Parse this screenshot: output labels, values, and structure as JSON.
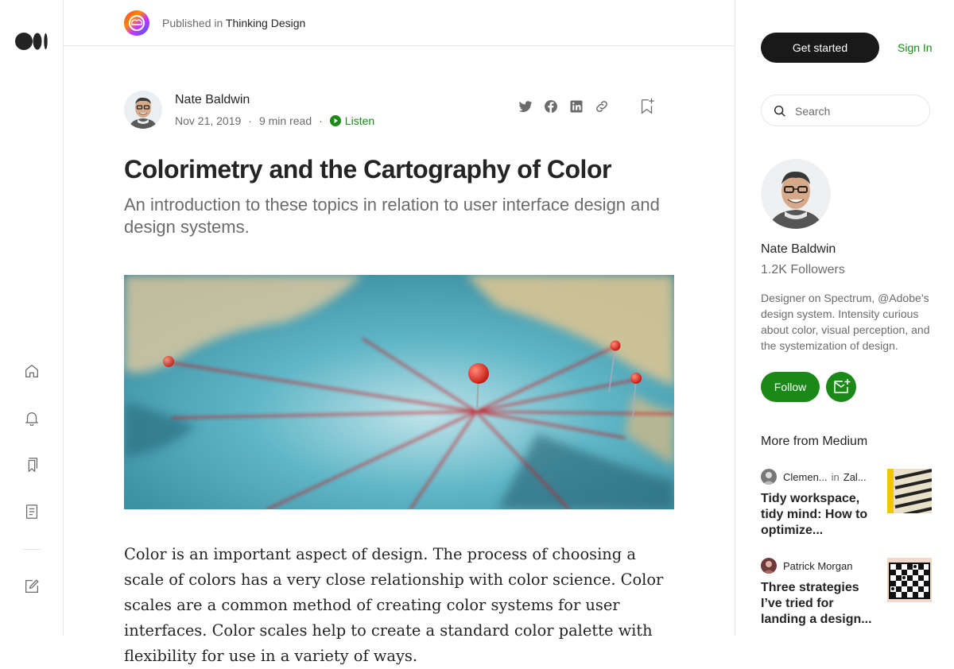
{
  "publication": {
    "published_in_label": "Published in",
    "name": "Thinking Design"
  },
  "article": {
    "author": "Nate Baldwin",
    "date": "Nov 21, 2019",
    "read_time": "9 min read",
    "dot": "·",
    "listen_label": "Listen",
    "title": "Colorimetry and the Cartography of Color",
    "subtitle": "An introduction to these topics in relation to user interface design and design systems.",
    "body": "Color is an important aspect of design. The process of choosing a scale of colors has a very close relationship with color science. Color scales are a common method of creating color systems for user interfaces. Color scales help to create a standard color palette with flexibility for use in a variety of ways."
  },
  "header": {
    "get_started_label": "Get started",
    "sign_in_label": "Sign In"
  },
  "search": {
    "placeholder": "Search"
  },
  "sidebar_author": {
    "name": "Nate Baldwin",
    "followers": "1.2K Followers",
    "bio": "Designer on Spectrum, @Adobe’s design system. Intensity curious about color, visual perception, and the systemization of design.",
    "follow_label": "Follow"
  },
  "more_from_medium": {
    "heading": "More from Medium",
    "stories": [
      {
        "author": "Clemen...",
        "in_label": "in",
        "publication": "Zal...",
        "title": "Tidy workspace, tidy mind: How to optimize..."
      },
      {
        "author": "Patrick Morgan",
        "title": "Three strategies I’ve tried for landing a design..."
      }
    ]
  },
  "icons": {
    "logo": "medium-logo-icon",
    "home": "home-icon",
    "notifications": "bell-icon",
    "lists": "bookmarks-icon",
    "stories": "document-icon",
    "write": "write-icon",
    "twitter": "twitter-icon",
    "facebook": "facebook-icon",
    "linkedin": "linkedin-icon",
    "copy_link": "link-icon",
    "bookmark": "bookmark-add-icon",
    "search": "search-icon",
    "subscribe": "mail-plus-icon",
    "play": "play-icon"
  },
  "colors": {
    "accent_green": "#1a8917",
    "button_dark": "#191919",
    "text_primary": "#242424",
    "text_secondary": "#6b6b6b",
    "divider": "#e6e6e6"
  }
}
